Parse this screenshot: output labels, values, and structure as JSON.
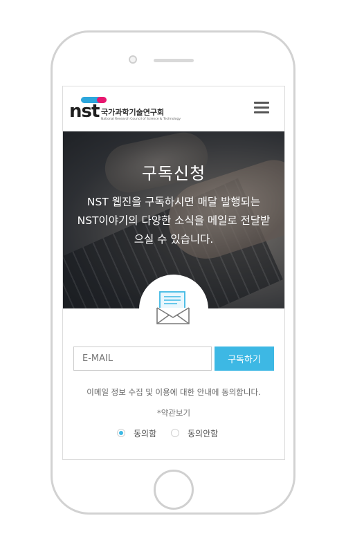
{
  "header": {
    "logo_mark": "nst",
    "logo_korean": "국가과학기술연구회",
    "logo_english": "National Research Council of Science & Technology",
    "menu_icon": "hamburger-menu-icon"
  },
  "hero": {
    "title": "구독신청",
    "description": "NST 웹진을 구독하시면 매달 발행되는 NST이야기의 다양한 소식을 메일로 전달받으실 수 있습니다.",
    "icon": "envelope-icon"
  },
  "form": {
    "email_placeholder": "E-MAIL",
    "email_value": "",
    "subscribe_label": "구독하기",
    "consent_text": "이메일 정보 수집 및 이용에 대한 안내에 동의합니다.",
    "terms_link": "*약관보기",
    "agree_label": "동의함",
    "disagree_label": "동의안함",
    "agree_selected": true
  },
  "colors": {
    "accent": "#3db8e4",
    "brand_blue": "#2ca6dc",
    "brand_pink": "#e8176f"
  }
}
